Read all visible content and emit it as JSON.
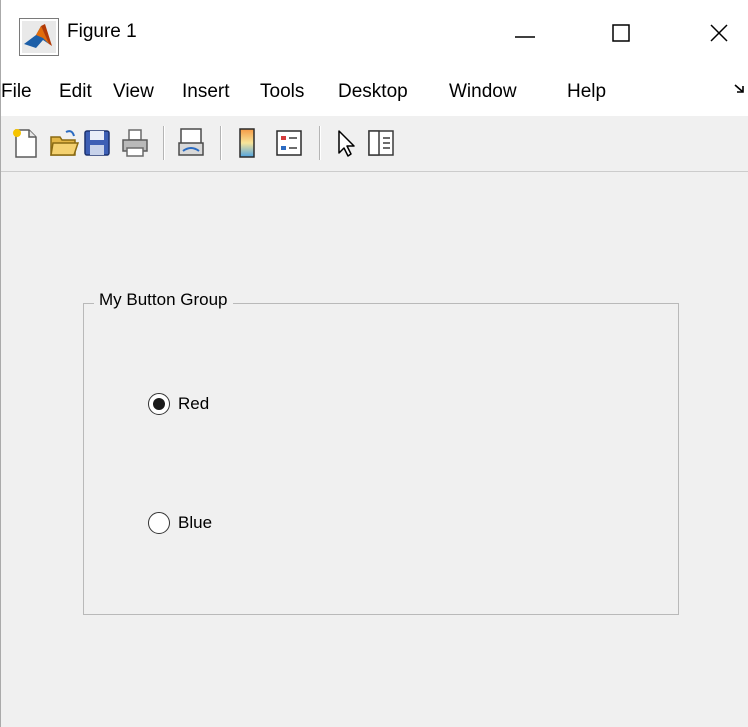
{
  "window": {
    "title": "Figure 1",
    "app_icon": "matlab-logo-icon",
    "controls": [
      "minimize-icon",
      "maximize-icon",
      "close-icon"
    ]
  },
  "menu": {
    "items": [
      "File",
      "Edit",
      "View",
      "Insert",
      "Tools",
      "Desktop",
      "Window",
      "Help"
    ],
    "overflow_icon": "menu-overflow-arrow-icon"
  },
  "toolbar": {
    "tools": [
      "new-figure-icon",
      "open-file-icon",
      "save-figure-icon",
      "print-figure-icon",
      "link-plot-icon",
      "insert-colorbar-icon",
      "insert-legend-icon",
      "edit-plot-arrow-icon",
      "property-editor-icon"
    ]
  },
  "button_group": {
    "title": "My Button Group",
    "options": [
      {
        "label": "Red",
        "selected": true
      },
      {
        "label": "Blue",
        "selected": false
      }
    ]
  },
  "colors": {
    "figure_background": "#f0f0f0",
    "chrome_background": "#ffffff",
    "group_border": "#b9b9b9"
  }
}
